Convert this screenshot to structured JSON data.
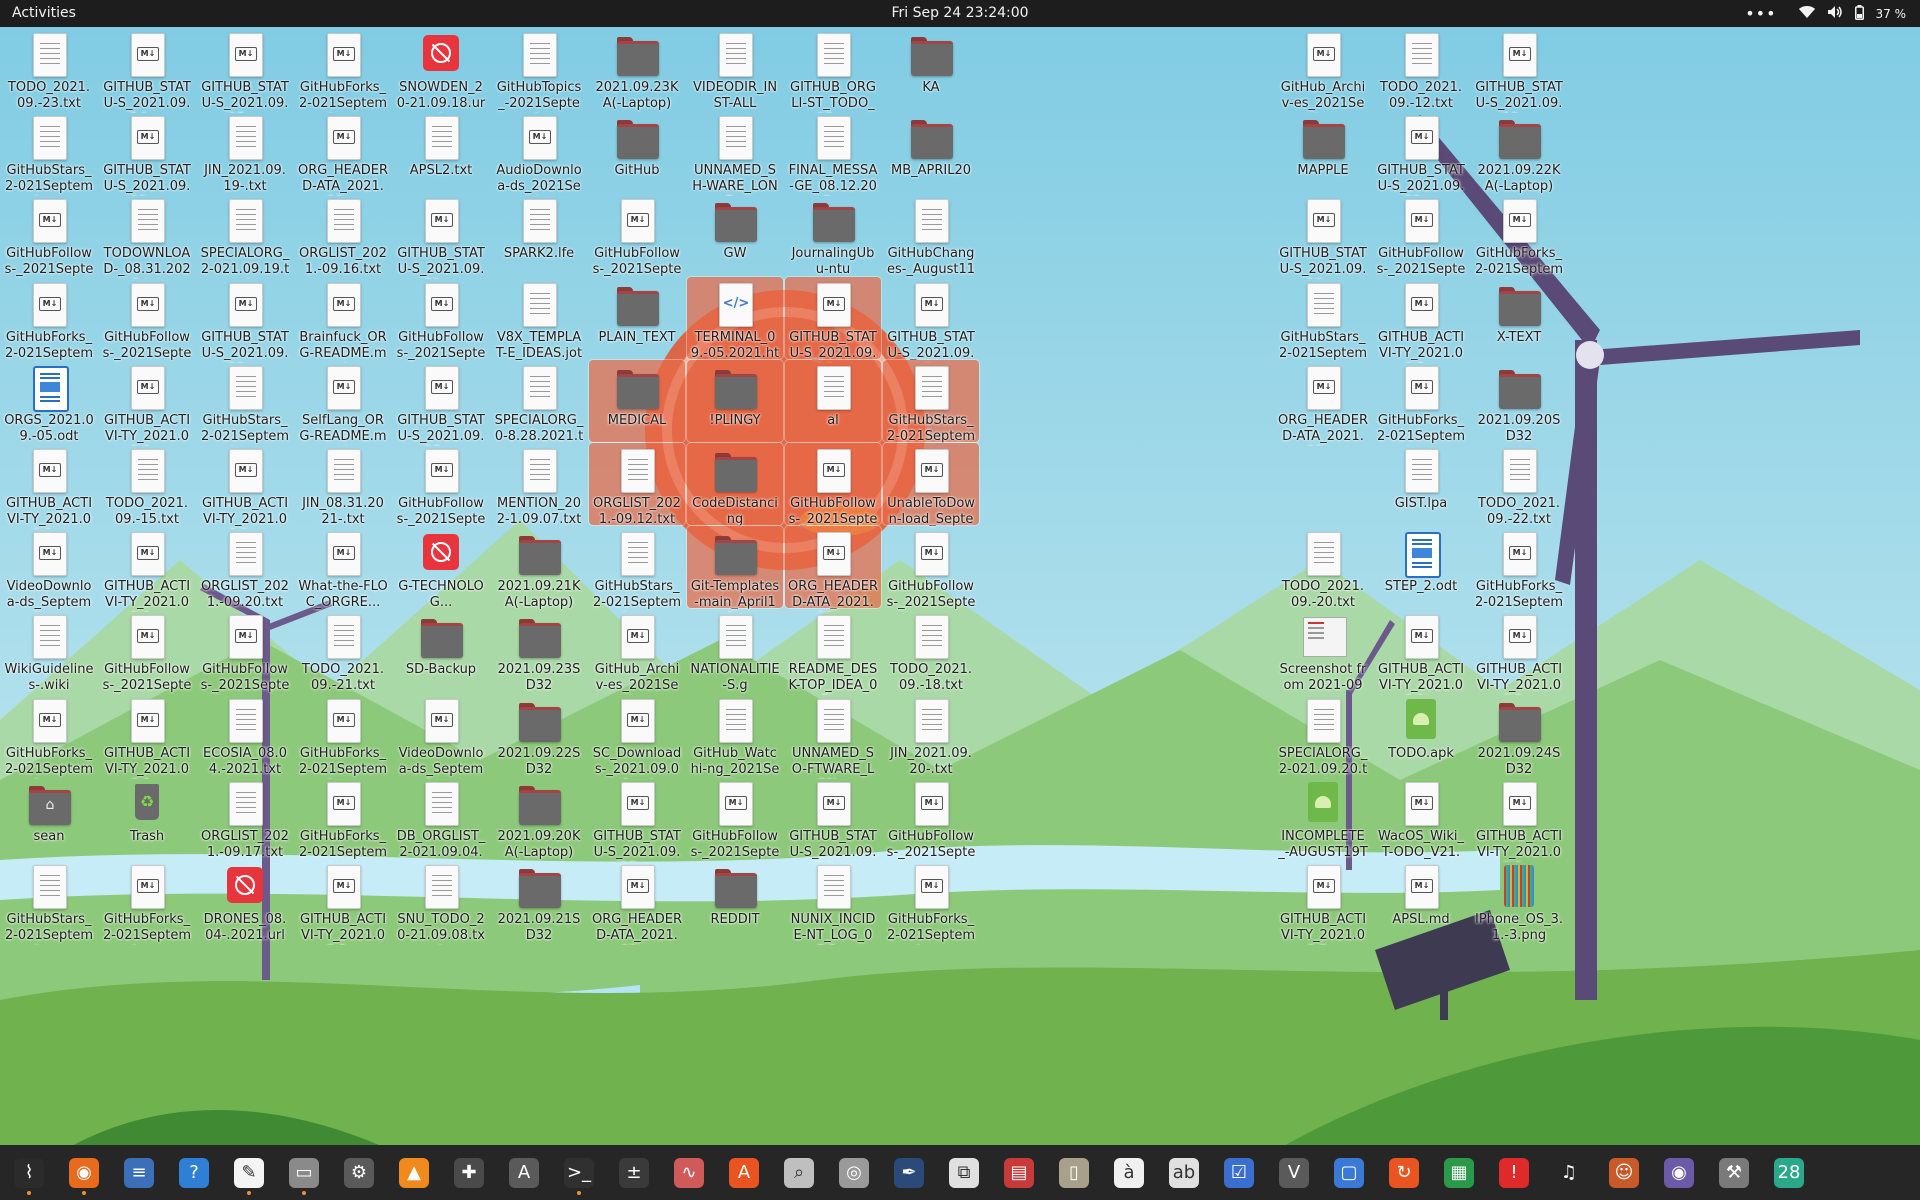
{
  "topbar": {
    "activities": "Activities",
    "clock": "Fri Sep 24  23:24:00",
    "battery": "37 %"
  },
  "desktop_icons": [
    {
      "label": "TODO_2021.09.-23.txt",
      "type": "txt",
      "col": 0,
      "row": 0
    },
    {
      "label": "GITHUB_STATU-S_2021.09.14....",
      "type": "md",
      "col": 1,
      "row": 0
    },
    {
      "label": "GITHUB_STATU-S_2021.09.15....",
      "type": "md",
      "col": 2,
      "row": 0
    },
    {
      "label": "GitHubForks_2-021Septembe...",
      "type": "md",
      "col": 3,
      "row": 0
    },
    {
      "label": "SNOWDEN_20-21.09.18.url",
      "type": "url",
      "col": 4,
      "row": 0
    },
    {
      "label": "GitHubTopics_-2021Septemb...",
      "type": "txt",
      "col": 5,
      "row": 0
    },
    {
      "label": "2021.09.23KA(-Laptop)",
      "type": "folder",
      "col": 6,
      "row": 0
    },
    {
      "label": "VIDEODIR_INST-ALL",
      "type": "txt",
      "col": 7,
      "row": 0
    },
    {
      "label": "GITHUB_ORGLI-ST_TODO_08....",
      "type": "txt",
      "col": 8,
      "row": 0
    },
    {
      "label": "KA",
      "type": "folder",
      "col": 9,
      "row": 0
    },
    {
      "label": "GitHub_Archiv-es_2021Septe...",
      "type": "md",
      "col": 13,
      "row": 0
    },
    {
      "label": "TODO_2021.09.-12.txt",
      "type": "txt",
      "col": 14,
      "row": 0
    },
    {
      "label": "GITHUB_STATU-S_2021.09.12....",
      "type": "md",
      "col": 15,
      "row": 0
    },
    {
      "label": "GitHubStars_2-021Septembe...",
      "type": "txt",
      "col": 0,
      "row": 1
    },
    {
      "label": "GITHUB_STATU-S_2021.09.11....",
      "type": "md",
      "col": 1,
      "row": 1
    },
    {
      "label": "JIN_2021.09.19-.txt",
      "type": "txt",
      "col": 2,
      "row": 1
    },
    {
      "label": "ORG_HEADERD-ATA_2021.09....",
      "type": "md",
      "col": 3,
      "row": 1
    },
    {
      "label": "APSL2.txt",
      "type": "txt",
      "col": 4,
      "row": 1
    },
    {
      "label": "AudioDownloa-ds_2021Sept...",
      "type": "md",
      "col": 5,
      "row": 1
    },
    {
      "label": "GitHub",
      "type": "folder",
      "col": 6,
      "row": 1
    },
    {
      "label": "UNNAMED_SH-WARE_LONG...",
      "type": "txt",
      "col": 7,
      "row": 1
    },
    {
      "label": "FINAL_MESSA-GE_08.12.202...",
      "type": "txt",
      "col": 8,
      "row": 1
    },
    {
      "label": "MB_APRIL20",
      "type": "folder",
      "col": 9,
      "row": 1
    },
    {
      "label": "MAPPLE",
      "type": "folder",
      "col": 13,
      "row": 1
    },
    {
      "label": "GITHUB_STATU-S_2021.09.22....",
      "type": "md",
      "col": 14,
      "row": 1
    },
    {
      "label": "2021.09.22KA(-Laptop)",
      "type": "folder",
      "col": 15,
      "row": 1
    },
    {
      "label": "GitHubFollows-_2021Septem...",
      "type": "md",
      "col": 0,
      "row": 2
    },
    {
      "label": "TODOWNLOAD-_08.31.2021.txt",
      "type": "txt",
      "col": 1,
      "row": 2
    },
    {
      "label": "SPECIALORG_2-021.09.19.txt",
      "type": "txt",
      "col": 2,
      "row": 2
    },
    {
      "label": "ORGLIST_2021.-09.16.txt",
      "type": "txt",
      "col": 3,
      "row": 2
    },
    {
      "label": "GITHUB_STATU-S_2021.09.21....",
      "type": "md",
      "col": 4,
      "row": 2
    },
    {
      "label": "SPARK2.lfe",
      "type": "txt",
      "col": 5,
      "row": 2
    },
    {
      "label": "GitHubFollows-_2021Septem...",
      "type": "md",
      "col": 6,
      "row": 2
    },
    {
      "label": "GW",
      "type": "folder",
      "col": 7,
      "row": 2
    },
    {
      "label": "JournalingUbu-ntu",
      "type": "folder",
      "col": 8,
      "row": 2
    },
    {
      "label": "GitHubChanges-_August11th2...",
      "type": "txt",
      "col": 9,
      "row": 2
    },
    {
      "label": "GITHUB_STATU-S_2021.09.18....",
      "type": "md",
      "col": 13,
      "row": 2
    },
    {
      "label": "GitHubFollows-_2021Septem...",
      "type": "md",
      "col": 14,
      "row": 2
    },
    {
      "label": "GitHubForks_2-021Septembe...",
      "type": "md",
      "col": 15,
      "row": 2
    },
    {
      "label": "GitHubForks_2-021Septembe...",
      "type": "md",
      "col": 0,
      "row": 3
    },
    {
      "label": "GitHubFollows-_2021Septem...",
      "type": "md",
      "col": 1,
      "row": 3
    },
    {
      "label": "GITHUB_STATU-S_2021.09.19....",
      "type": "md",
      "col": 2,
      "row": 3
    },
    {
      "label": "Brainfuck_ORG-README.md",
      "type": "md",
      "col": 3,
      "row": 3
    },
    {
      "label": "GitHubFollows-_2021Septem...",
      "type": "md",
      "col": 4,
      "row": 3
    },
    {
      "label": "V8X_TEMPLAT-E_IDEAS.jot",
      "type": "txt",
      "col": 5,
      "row": 3
    },
    {
      "label": "PLAIN_TEXT",
      "type": "folder",
      "col": 6,
      "row": 3
    },
    {
      "label": "TERMINAL_09.-05.2021.htm",
      "type": "html",
      "col": 7,
      "row": 3,
      "selected": true
    },
    {
      "label": "GITHUB_STATU-S_2021.09.16....",
      "type": "md",
      "col": 8,
      "row": 3,
      "selected": true
    },
    {
      "label": "GITHUB_STATU-S_2021.09.17....",
      "type": "md",
      "col": 9,
      "row": 3
    },
    {
      "label": "GitHubStars_2-021Septembe...",
      "type": "txt",
      "col": 13,
      "row": 3
    },
    {
      "label": "GITHUB_ACTIVI-TY_2021.09.2...",
      "type": "md",
      "col": 14,
      "row": 3
    },
    {
      "label": "X-TEXT",
      "type": "folder",
      "col": 15,
      "row": 3
    },
    {
      "label": "ORGS_2021.09.-05.odt",
      "type": "odt",
      "col": 0,
      "row": 4
    },
    {
      "label": "GITHUB_ACTIVI-TY_2021.09.1...",
      "type": "md",
      "col": 1,
      "row": 4
    },
    {
      "label": "GitHubStars_2-021Septembe...",
      "type": "txt",
      "col": 2,
      "row": 4
    },
    {
      "label": "SelfLang_ORG-README.md",
      "type": "md",
      "col": 3,
      "row": 4
    },
    {
      "label": "GITHUB_STATU-S_2021.09.23....",
      "type": "md",
      "col": 4,
      "row": 4
    },
    {
      "label": "SPECIALORG_0-8.28.2021.txt",
      "type": "txt",
      "col": 5,
      "row": 4
    },
    {
      "label": "MEDICAL",
      "type": "folder",
      "col": 6,
      "row": 4,
      "selected": true
    },
    {
      "label": "!PLINGY",
      "type": "folder",
      "col": 7,
      "row": 4,
      "selected": true
    },
    {
      "label": "al",
      "type": "txt",
      "col": 8,
      "row": 4,
      "selected": true
    },
    {
      "label": "GitHubStars_2-021Septembe...",
      "type": "txt",
      "col": 9,
      "row": 4,
      "selected": true
    },
    {
      "label": "ORG_HEADERD-ATA_2021.09....",
      "type": "md",
      "col": 13,
      "row": 4
    },
    {
      "label": "GitHubForks_2-021Septembe...",
      "type": "md",
      "col": 14,
      "row": 4
    },
    {
      "label": "2021.09.20SD32",
      "type": "folder",
      "col": 15,
      "row": 4
    },
    {
      "label": "GITHUB_ACTIVI-TY_2021.09.1...",
      "type": "md",
      "col": 0,
      "row": 5
    },
    {
      "label": "TODO_2021.09.-15.txt",
      "type": "txt",
      "col": 1,
      "row": 5
    },
    {
      "label": "GITHUB_ACTIVI-TY_2021.09.1...",
      "type": "md",
      "col": 2,
      "row": 5
    },
    {
      "label": "JIN_08.31.2021-.txt",
      "type": "txt",
      "col": 3,
      "row": 5
    },
    {
      "label": "GitHubFollows-_2021Septem...",
      "type": "md",
      "col": 4,
      "row": 5
    },
    {
      "label": "MENTION_202-1.09.07.txt",
      "type": "txt",
      "col": 5,
      "row": 5
    },
    {
      "label": "ORGLIST_2021.-09.12.txt",
      "type": "txt",
      "col": 6,
      "row": 5,
      "selected": true
    },
    {
      "label": "CodeDistancing",
      "type": "folder",
      "col": 7,
      "row": 5,
      "selected": true
    },
    {
      "label": "GitHubFollows-_2021Septem...",
      "type": "md",
      "col": 8,
      "row": 5,
      "selected": true
    },
    {
      "label": "UnableToDown-load_Septem...",
      "type": "md",
      "col": 9,
      "row": 5,
      "selected": true
    },
    {
      "label": "GIST.lpa",
      "type": "txt",
      "col": 14,
      "row": 5
    },
    {
      "label": "TODO_2021.09.-22.txt",
      "type": "txt",
      "col": 15,
      "row": 5
    },
    {
      "label": "VideoDownloa-ds_Septembe...",
      "type": "md",
      "col": 0,
      "row": 6
    },
    {
      "label": "GITHUB_ACTIVI-TY_2021.09.1...",
      "type": "md",
      "col": 1,
      "row": 6
    },
    {
      "label": "ORGLIST_2021.-09.20.txt",
      "type": "txt",
      "col": 2,
      "row": 6
    },
    {
      "label": "What-the-FLOC_ORGRE...",
      "type": "md",
      "col": 3,
      "row": 6
    },
    {
      "label": "G-TECHNOLOG...",
      "type": "url",
      "col": 4,
      "row": 6
    },
    {
      "label": "2021.09.21KA(-Laptop)",
      "type": "folder",
      "col": 5,
      "row": 6
    },
    {
      "label": "GitHubStars_2-021Septembe...",
      "type": "txt",
      "col": 6,
      "row": 6
    },
    {
      "label": "Git-Templates-main_April14...",
      "type": "folder",
      "col": 7,
      "row": 6,
      "selected": true
    },
    {
      "label": "ORG_HEADERD-ATA_2021.09....",
      "type": "md",
      "col": 8,
      "row": 6,
      "selected": true
    },
    {
      "label": "GitHubFollows-_2021Septem...",
      "type": "md",
      "col": 9,
      "row": 6
    },
    {
      "label": "TODO_2021.09.-20.txt",
      "type": "txt",
      "col": 13,
      "row": 6
    },
    {
      "label": "STEP_2.odt",
      "type": "odt",
      "col": 14,
      "row": 6
    },
    {
      "label": "GitHubForks_2-021Septembe...",
      "type": "md",
      "col": 15,
      "row": 6
    },
    {
      "label": "WikiGuidelines-.wiki",
      "type": "txt",
      "col": 0,
      "row": 7
    },
    {
      "label": "GitHubFollows-_2021Septem...",
      "type": "md",
      "col": 1,
      "row": 7
    },
    {
      "label": "GitHubFollows-_2021Septem...",
      "type": "md",
      "col": 2,
      "row": 7
    },
    {
      "label": "TODO_2021.09.-21.txt",
      "type": "txt",
      "col": 3,
      "row": 7
    },
    {
      "label": "SD-Backup",
      "type": "folder",
      "col": 4,
      "row": 7
    },
    {
      "label": "2021.09.23SD32",
      "type": "folder",
      "col": 5,
      "row": 7
    },
    {
      "label": "GitHub_Archiv-es_2021Septe...",
      "type": "md",
      "col": 6,
      "row": 7
    },
    {
      "label": "NATIONALITIE-S.g",
      "type": "txt",
      "col": 7,
      "row": 7
    },
    {
      "label": "README_DESK-TOP_IDEA_08....",
      "type": "txt",
      "col": 8,
      "row": 7
    },
    {
      "label": "TODO_2021.09.-18.txt",
      "type": "txt",
      "col": 9,
      "row": 7
    },
    {
      "label": "Screenshot from 2021-09-...",
      "type": "shot",
      "col": 13,
      "row": 7
    },
    {
      "label": "GITHUB_ACTIVI-TY_2021.09.1...",
      "type": "md",
      "col": 14,
      "row": 7
    },
    {
      "label": "GITHUB_ACTIVI-TY_2021.09.2...",
      "type": "md",
      "col": 15,
      "row": 7
    },
    {
      "label": "GitHubForks_2-021Septembe...",
      "type": "md",
      "col": 0,
      "row": 8
    },
    {
      "label": "GITHUB_ACTIVI-TY_2021.09.1...",
      "type": "md",
      "col": 1,
      "row": 8
    },
    {
      "label": "ECOSIA_08.04.-2021.txt",
      "type": "txt",
      "col": 2,
      "row": 8
    },
    {
      "label": "GitHubForks_2-021Septembe...",
      "type": "md",
      "col": 3,
      "row": 8
    },
    {
      "label": "VideoDownloa-ds_Septembe...",
      "type": "md",
      "col": 4,
      "row": 8
    },
    {
      "label": "2021.09.22SD32",
      "type": "folder",
      "col": 5,
      "row": 8
    },
    {
      "label": "SC_Downloads-_2021.09.04.md",
      "type": "md",
      "col": 6,
      "row": 8
    },
    {
      "label": "GitHub_Watchi-ng_2021Sept...",
      "type": "txt",
      "col": 7,
      "row": 8
    },
    {
      "label": "UNNAMED_SO-FTWARE_LON...",
      "type": "txt",
      "col": 8,
      "row": 8
    },
    {
      "label": "JIN_2021.09.20-.txt",
      "type": "txt",
      "col": 9,
      "row": 8
    },
    {
      "label": "SPECIALORG_2-021.09.20.txt",
      "type": "txt",
      "col": 13,
      "row": 8
    },
    {
      "label": "TODO.apk",
      "type": "apk",
      "col": 14,
      "row": 8
    },
    {
      "label": "2021.09.24SD32",
      "type": "folder",
      "col": 15,
      "row": 8
    },
    {
      "label": "sean",
      "type": "home",
      "col": 0,
      "row": 9
    },
    {
      "label": "Trash",
      "type": "trash",
      "col": 1,
      "row": 9
    },
    {
      "label": "ORGLIST_2021.-09.17.txt",
      "type": "txt",
      "col": 2,
      "row": 9
    },
    {
      "label": "GitHubForks_2-021Septembe...",
      "type": "md",
      "col": 3,
      "row": 9
    },
    {
      "label": "DB_ORGLIST_2-021.09.04.csv",
      "type": "txt",
      "col": 4,
      "row": 9
    },
    {
      "label": "2021.09.20KA(-Laptop)",
      "type": "folder",
      "col": 5,
      "row": 9
    },
    {
      "label": "GITHUB_STATU-S_2021.09.13....",
      "type": "md",
      "col": 6,
      "row": 9
    },
    {
      "label": "GitHubFollows-_2021Septem...",
      "type": "md",
      "col": 7,
      "row": 9
    },
    {
      "label": "GITHUB_STATU-S_2021.09.20....",
      "type": "md",
      "col": 8,
      "row": 9
    },
    {
      "label": "GitHubFollows-_2021Septem...",
      "type": "md",
      "col": 9,
      "row": 9
    },
    {
      "label": "INCOMPLETE_-AUGUST19TH....",
      "type": "apk",
      "col": 13,
      "row": 9
    },
    {
      "label": "WacOS_Wiki_T-ODO_V21.md",
      "type": "md",
      "col": 14,
      "row": 9
    },
    {
      "label": "GITHUB_ACTIVI-TY_2021.09.1...",
      "type": "md",
      "col": 15,
      "row": 9
    },
    {
      "label": "GitHubStars_2-021Septembe...",
      "type": "txt",
      "col": 0,
      "row": 10
    },
    {
      "label": "GitHubForks_2-021Septembe...",
      "type": "md",
      "col": 1,
      "row": 10
    },
    {
      "label": "DRONES_08.04-.2021.url",
      "type": "url",
      "col": 2,
      "row": 10
    },
    {
      "label": "GITHUB_ACTIVI-TY_2021.09.1...",
      "type": "md",
      "col": 3,
      "row": 10
    },
    {
      "label": "SNU_TODO_20-21.09.08.txt",
      "type": "txt",
      "col": 4,
      "row": 10
    },
    {
      "label": "2021.09.21SD32",
      "type": "folder",
      "col": 5,
      "row": 10
    },
    {
      "label": "ORG_HEADERD-ATA_2021.09....",
      "type": "md",
      "col": 6,
      "row": 10
    },
    {
      "label": "REDDIT",
      "type": "folder",
      "col": 7,
      "row": 10
    },
    {
      "label": "NUNIX_INCIDE-NT_LOG_08.1...",
      "type": "txt",
      "col": 8,
      "row": 10
    },
    {
      "label": "GitHubForks_2-021Septembe...",
      "type": "md",
      "col": 9,
      "row": 10
    },
    {
      "label": "GITHUB_ACTIVI-TY_2021.09.2...",
      "type": "md",
      "col": 13,
      "row": 10
    },
    {
      "label": "APSL.md",
      "type": "md",
      "col": 14,
      "row": 10
    },
    {
      "label": "IPhone_OS_3.1.-3.png",
      "type": "png",
      "col": 15,
      "row": 10
    }
  ],
  "dock": [
    {
      "name": "system-monitor",
      "glyph": "⌇",
      "color": "#2b2b2b",
      "running": true
    },
    {
      "name": "firefox",
      "glyph": "◉",
      "color": "#e86a1c",
      "running": true
    },
    {
      "name": "text-editor",
      "glyph": "≡",
      "color": "#3b6fb8",
      "running": false
    },
    {
      "name": "help",
      "glyph": "?",
      "color": "#2f7fd6",
      "running": false
    },
    {
      "name": "notes",
      "glyph": "✎",
      "color": "#f4f4f4",
      "running": true
    },
    {
      "name": "files",
      "glyph": "▭",
      "color": "#8a8a8a",
      "running": true
    },
    {
      "name": "settings",
      "glyph": "⚙",
      "color": "#5a5a5a",
      "running": false
    },
    {
      "name": "vlc",
      "glyph": "▲",
      "color": "#f08a1c",
      "running": false
    },
    {
      "name": "image-viewer",
      "glyph": "✚",
      "color": "#4a4a4a",
      "running": false
    },
    {
      "name": "app-center",
      "glyph": "A",
      "color": "#5a5a5a",
      "running": false
    },
    {
      "name": "terminal",
      "glyph": ">_",
      "color": "#303030",
      "running": true
    },
    {
      "name": "calculator",
      "glyph": "±",
      "color": "#3a3a3a",
      "running": false
    },
    {
      "name": "pulse",
      "glyph": "∿",
      "color": "#d05a5a",
      "running": false
    },
    {
      "name": "software",
      "glyph": "A",
      "color": "#e95420",
      "running": false
    },
    {
      "name": "search",
      "glyph": "⌕",
      "color": "#bfbfbf",
      "running": false
    },
    {
      "name": "disks",
      "glyph": "◎",
      "color": "#9a9a9a",
      "running": false
    },
    {
      "name": "inkscape",
      "glyph": "✒",
      "color": "#2a4a7a",
      "running": false
    },
    {
      "name": "screenshot",
      "glyph": "⧉",
      "color": "#e0e0e0",
      "running": false
    },
    {
      "name": "pdf",
      "glyph": "▤",
      "color": "#c83a3a",
      "running": false
    },
    {
      "name": "archive",
      "glyph": "▯",
      "color": "#a8a08a",
      "running": false
    },
    {
      "name": "character-map",
      "glyph": "à",
      "color": "#f0f0f0",
      "running": false
    },
    {
      "name": "fonts",
      "glyph": "ab",
      "color": "#e0e0e0",
      "running": false
    },
    {
      "name": "tasks",
      "glyph": "☑",
      "color": "#3a6fd0",
      "running": false
    },
    {
      "name": "vim",
      "glyph": "V",
      "color": "#5a5a5a",
      "running": false
    },
    {
      "name": "remote-desktop",
      "glyph": "▢",
      "color": "#3a7ad6",
      "running": false
    },
    {
      "name": "updater",
      "glyph": "↻",
      "color": "#e95420",
      "running": false
    },
    {
      "name": "spreadsheet",
      "glyph": "▦",
      "color": "#2a9a4a",
      "running": false
    },
    {
      "name": "alert",
      "glyph": "!",
      "color": "#e02a2a",
      "running": false
    },
    {
      "name": "music",
      "glyph": "♫",
      "color": "#262626",
      "running": false
    },
    {
      "name": "game",
      "glyph": "☺",
      "color": "#c85a2a",
      "running": false
    },
    {
      "name": "webcam",
      "glyph": "◉",
      "color": "#6a5aa8",
      "running": false
    },
    {
      "name": "tools",
      "glyph": "⚒",
      "color": "#7a7a7a",
      "running": false
    },
    {
      "name": "calendar",
      "glyph": "28",
      "color": "#2aa88a",
      "running": false
    }
  ]
}
